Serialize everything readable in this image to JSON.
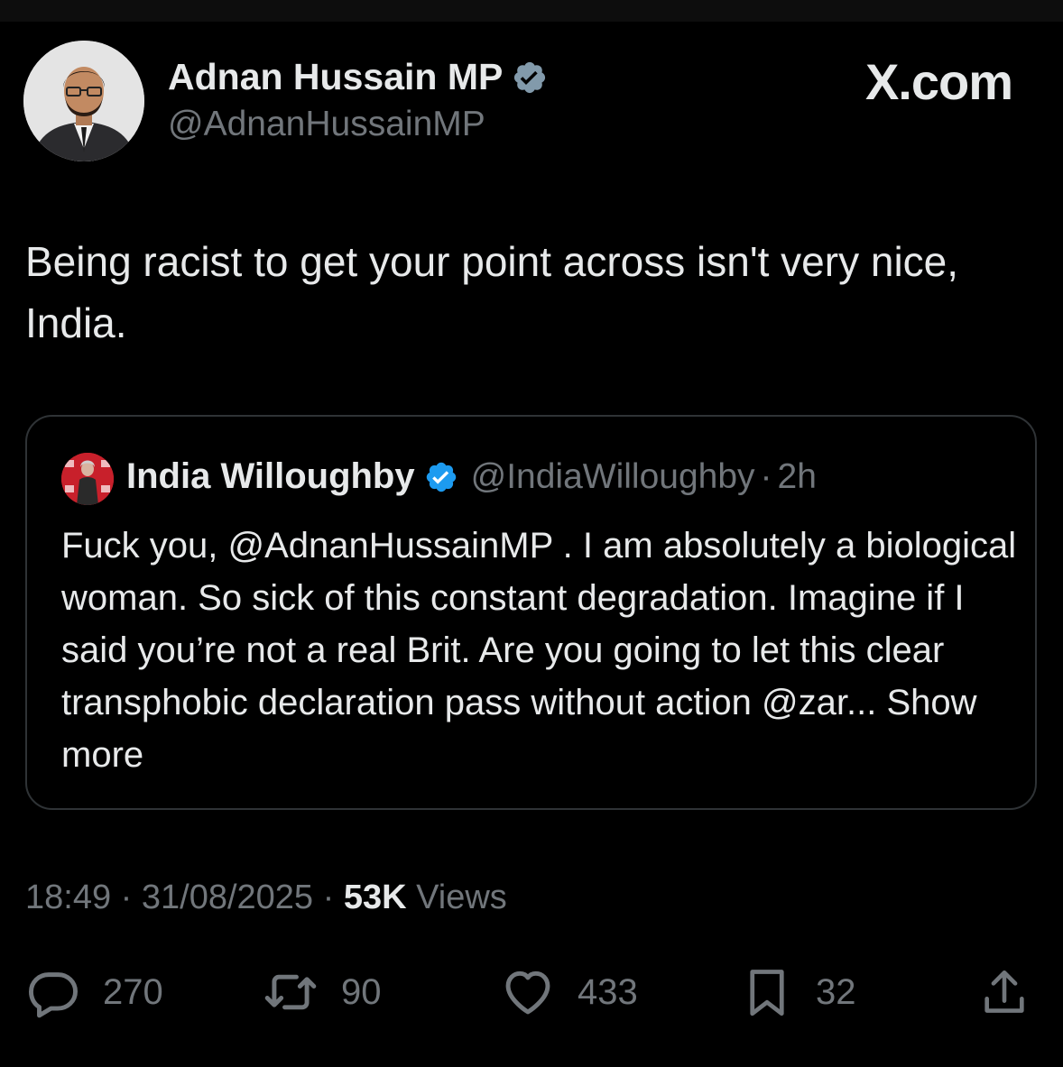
{
  "author": {
    "name": "Adnan Hussain MP",
    "handle": "@AdnanHussainMP",
    "verified": true
  },
  "brand": "X.com",
  "tweet": {
    "text": "Being racist to get your point across isn't very nice, India."
  },
  "quoted": {
    "name": "India Willoughby",
    "handle": "@IndiaWilloughby",
    "separator": "·",
    "time": "2h",
    "verified": true,
    "text": "Fuck you, @AdnanHussainMP . I am absolutely a biological woman. So sick of this constant degradation. Imagine if I said you’re not a real Brit. Are you going to let this clear transphobic declaration pass without action @zar...",
    "show_more": "Show more"
  },
  "meta": {
    "time": "18:49",
    "date": "31/08/2025",
    "separator": "·",
    "views_count": "53K",
    "views_label": "Views"
  },
  "actions": {
    "replies": "270",
    "reposts": "90",
    "likes": "433",
    "bookmarks": "32"
  },
  "icons": {
    "reply": "reply-icon",
    "repost": "repost-icon",
    "like": "heart-icon",
    "bookmark": "bookmark-icon",
    "share": "share-icon",
    "verified": "verified-badge-icon"
  },
  "colors": {
    "background": "#000000",
    "text": "#e7e9ea",
    "secondary": "#71767b",
    "border": "#2f3336",
    "verified_author": "#829aab",
    "verified_quoted": "#1d9bf0"
  }
}
